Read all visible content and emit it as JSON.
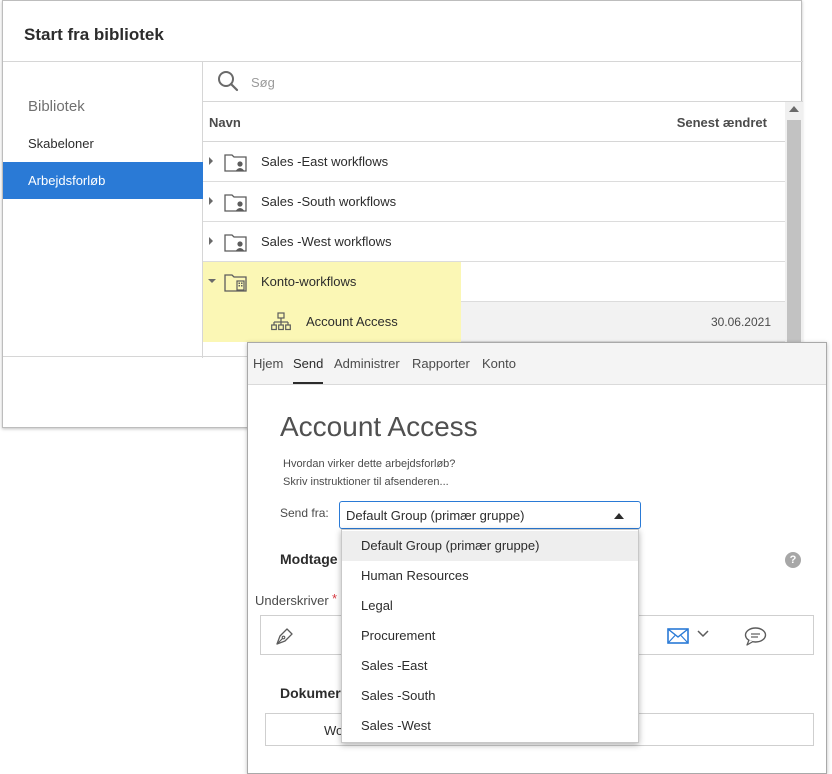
{
  "library_dialog": {
    "title": "Start fra bibliotek",
    "sidebar": {
      "heading": "Bibliotek",
      "items": [
        {
          "label": "Skabeloner"
        },
        {
          "label": "Arbejdsforløb"
        }
      ]
    },
    "search": {
      "placeholder": "Søg"
    },
    "table": {
      "columns": {
        "name": "Navn",
        "modified": "Senest ændret"
      },
      "rows": [
        {
          "label": "Sales -East workflows",
          "date": ""
        },
        {
          "label": "Sales -South workflows",
          "date": ""
        },
        {
          "label": "Sales -West workflows",
          "date": ""
        },
        {
          "label": "Konto-workflows",
          "date": ""
        },
        {
          "label": "Account Access",
          "date": "30.06.2021"
        }
      ]
    }
  },
  "send_panel": {
    "nav": {
      "tabs": [
        "Hjem",
        "Send",
        "Administrer",
        "Rapporter",
        "Konto"
      ]
    },
    "workflow": {
      "title": "Account Access",
      "description_line1": "Hvordan virker dette arbejdsforløb?",
      "description_line2": "Skriv instruktioner til afsenderen..."
    },
    "send_from": {
      "label": "Send fra:",
      "value": "Default Group (primær gruppe)",
      "options": [
        "Default Group (primær gruppe)",
        "Human Resources",
        "Legal",
        "Procurement",
        "Sales -East",
        "Sales -South",
        "Sales -West"
      ]
    },
    "recipients": {
      "heading_visible": "Modtage",
      "signer_label": "Underskriver",
      "required_mark": "*"
    },
    "documents": {
      "heading_visible": "Dokumer",
      "field_text_visible": "Wo"
    },
    "help_glyph": "?",
    "icons": [
      "search-icon",
      "folder-user-icon",
      "folder-account-icon",
      "workflow-icon",
      "pen-icon",
      "mail-icon",
      "chevron-down-icon",
      "comment-icon",
      "help-icon"
    ]
  },
  "colors": {
    "accent": "#2a7ad6",
    "highlight": "#fbf7b5",
    "required": "#d7373f"
  }
}
